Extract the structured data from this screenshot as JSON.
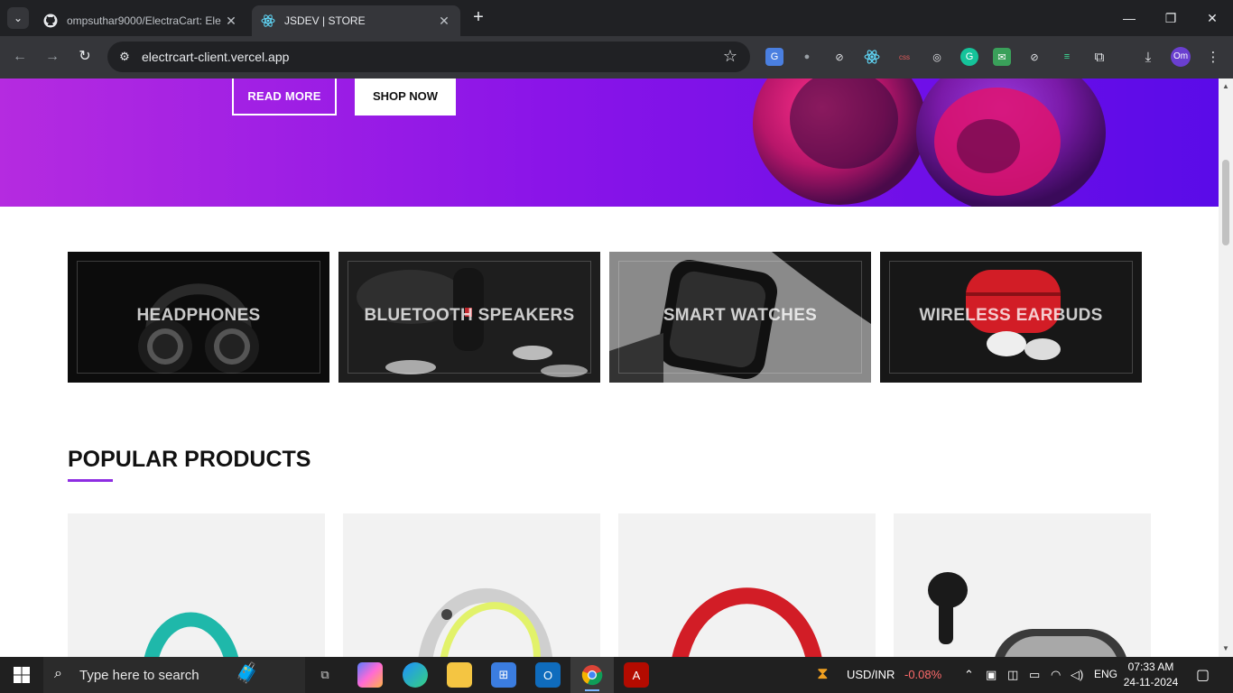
{
  "browser": {
    "tabs": [
      {
        "title": "ompsuthar9000/ElectraCart: Ele",
        "active": false
      },
      {
        "title": "JSDEV | STORE",
        "active": true
      }
    ],
    "url": "electrcart-client.vercel.app",
    "profile_initials": "Om"
  },
  "hero": {
    "read_more_label": "READ MORE",
    "shop_now_label": "SHOP NOW"
  },
  "categories": [
    {
      "label": "HEADPHONES"
    },
    {
      "label": "BLUETOOTH SPEAKERS"
    },
    {
      "label": "SMART WATCHES"
    },
    {
      "label": "WIRELESS EARBUDS"
    }
  ],
  "popular": {
    "title": "POPULAR PRODUCTS",
    "accent": "#8e2de2"
  },
  "taskbar": {
    "search_placeholder": "Type here to search",
    "ticker_label": "USD/INR",
    "ticker_change": "-0.08%",
    "language": "ENG",
    "time": "07:33 AM",
    "date": "24-11-2024"
  }
}
